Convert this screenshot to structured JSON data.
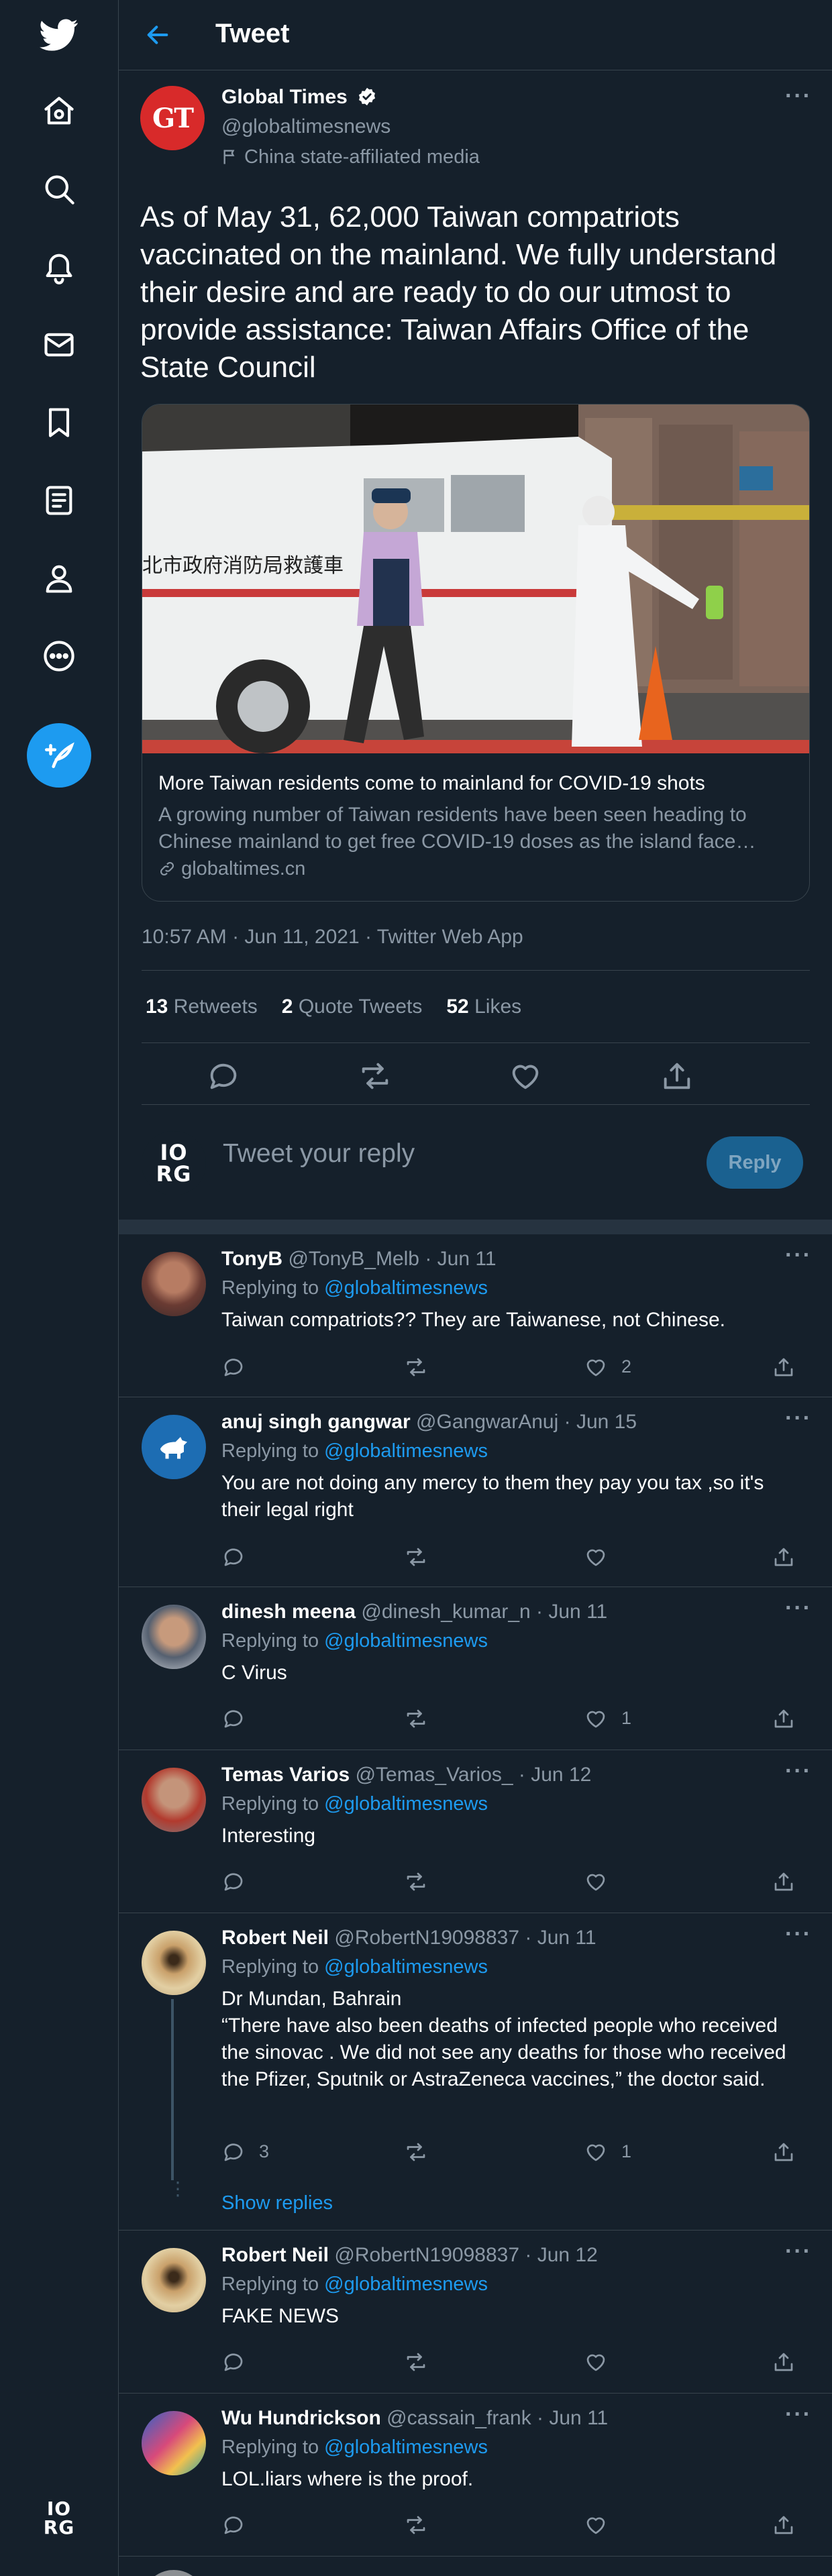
{
  "header": {
    "title": "Tweet"
  },
  "main_tweet": {
    "author": "Global Times",
    "avatar_text": "GT",
    "handle": "@globaltimesnews",
    "affiliation": "China state-affiliated media",
    "text": "As of May 31, 62,000 Taiwan compatriots vaccinated on the mainland. We fully understand their desire and are ready to do our utmost to provide assistance: Taiwan Affairs Office of the State Council",
    "card": {
      "image_sign": "北市政府消防局救護車",
      "title": "More Taiwan residents come to mainland for COVID-19 shots",
      "desc_line1": "A growing number of Taiwan residents have been seen heading to",
      "desc_line2": "Chinese mainland to get free COVID-19 doses as the island face…",
      "domain": "globaltimes.cn"
    },
    "meta": "10:57 AM · Jun 11, 2021 · Twitter Web App",
    "stats": {
      "retweets_count": "13",
      "retweets_label": "Retweets",
      "quotes_count": "2",
      "quotes_label": "Quote Tweets",
      "likes_count": "52",
      "likes_label": "Likes"
    }
  },
  "reply_box": {
    "avatar_text_top": "IO",
    "avatar_text_bottom": "RG",
    "placeholder": "Tweet your reply",
    "button": "Reply"
  },
  "replying_label": "Replying to",
  "replies": [
    {
      "name": "TonyB",
      "handle": "@TonyB_Melb",
      "date": "Jun 11",
      "to": "@globaltimesnews",
      "text": "Taiwan compatriots?? They are Taiwanese, not Chinese.",
      "reply_count": "",
      "like_count": "2"
    },
    {
      "name": "anuj singh gangwar",
      "handle": "@GangwarAnuj",
      "date": "Jun 15",
      "to": "@globaltimesnews",
      "text": "You are not doing any mercy to them they pay you tax ,so it's their legal right",
      "reply_count": "",
      "like_count": ""
    },
    {
      "name": "dinesh meena",
      "handle": "@dinesh_kumar_n",
      "date": "Jun 11",
      "to": "@globaltimesnews",
      "text": "C Virus",
      "reply_count": "",
      "like_count": "1"
    },
    {
      "name": "Temas Varios",
      "handle": "@Temas_Varios_",
      "date": "Jun 12",
      "to": "@globaltimesnews",
      "text": "Interesting",
      "reply_count": "",
      "like_count": ""
    },
    {
      "name": "Robert Neil",
      "handle": "@RobertN19098837",
      "date": "Jun 11",
      "to": "@globaltimesnews",
      "text": "Dr Mundan, Bahrain\n“There have also been deaths of infected people who received the sinovac . We did not see any deaths for those who received the Pfizer, Sputnik or AstraZeneca vaccines,” the doctor said.",
      "reply_count": "3",
      "like_count": "1",
      "show_replies": "Show replies"
    },
    {
      "name": "Robert Neil",
      "handle": "@RobertN19098837",
      "date": "Jun 12",
      "to": "@globaltimesnews",
      "text": "FAKE NEWS",
      "reply_count": "",
      "like_count": ""
    },
    {
      "name": "Wu Hundrickson",
      "handle": "@cassain_frank",
      "date": "Jun 11",
      "to": "@globaltimesnews",
      "text": "LOL.liars where is the proof.",
      "reply_count": "",
      "like_count": ""
    }
  ],
  "colors": {
    "background": "#15202b",
    "accent": "#1d9bf0",
    "muted": "#8b98a5",
    "border": "#38444d"
  }
}
